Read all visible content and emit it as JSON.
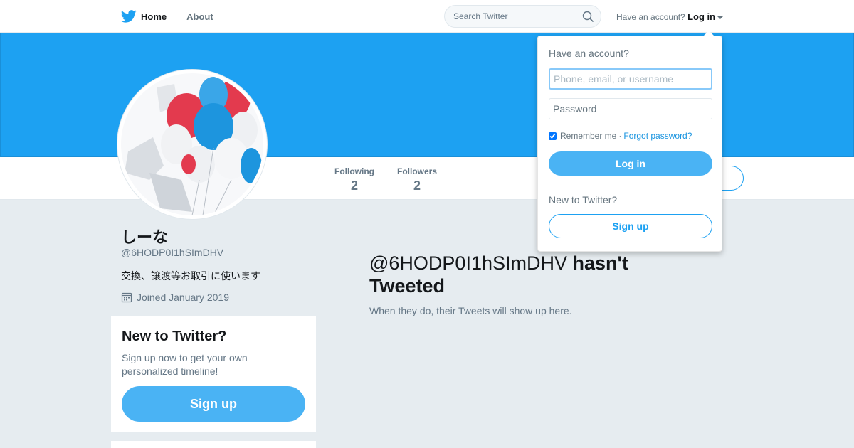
{
  "nav": {
    "home_label": "Home",
    "about_label": "About",
    "search_placeholder": "Search Twitter",
    "account_prompt": "Have an account?",
    "login_label": "Log in"
  },
  "profile": {
    "name": "しーな",
    "handle": "@6HODP0I1hSImDHV",
    "bio": "交換、譲渡等お取引に使います",
    "joined": "Joined January 2019",
    "stats": [
      {
        "label": "Following",
        "value": "2"
      },
      {
        "label": "Followers",
        "value": "2"
      }
    ]
  },
  "signup_card": {
    "title": "New to Twitter?",
    "text": "Sign up now to get your own personalized timeline!",
    "button_label": "Sign up"
  },
  "timeline": {
    "empty_handle": "@6HODP0I1hSImDHV",
    "empty_suffix": "hasn't Tweeted",
    "empty_sub": "When they do, their Tweets will show up here."
  },
  "login_dropdown": {
    "heading": "Have an account?",
    "username_placeholder": "Phone, email, or username",
    "password_placeholder": "Password",
    "remember_label": "Remember me",
    "separator": "·",
    "forgot_label": "Forgot password?",
    "login_button": "Log in",
    "new_prompt": "New to Twitter?",
    "signup_button": "Sign up"
  },
  "colors": {
    "brand": "#1da1f2",
    "button": "#4ab3f4",
    "link": "#1b95e0",
    "page_bg": "#e6ecf0"
  },
  "icons": [
    "twitter-bird-icon",
    "search-icon",
    "chevron-down-icon",
    "calendar-icon"
  ]
}
